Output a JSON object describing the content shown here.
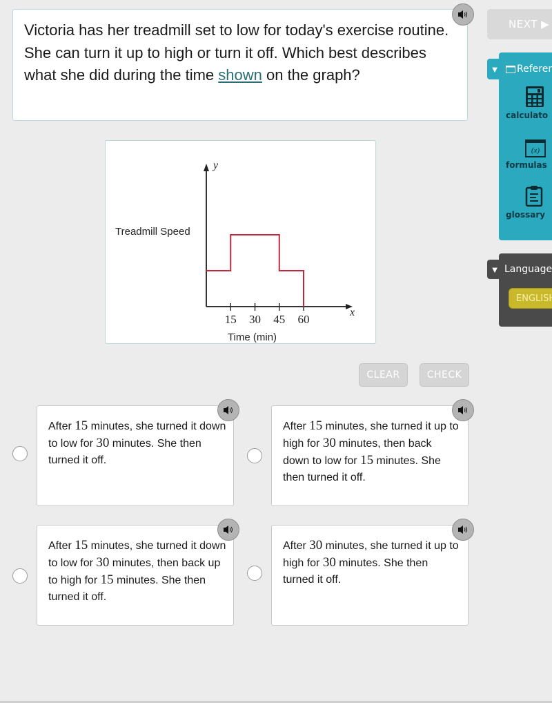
{
  "question": {
    "text_before_link": "Victoria has her treadmill set to low for today's exercise routine. She can turn it up to high or turn it off. Which best describes what she did during the time ",
    "link_text": "shown",
    "text_after_link": " on the graph?",
    "audio_icon": "speaker-icon"
  },
  "nav": {
    "next_label": "NEXT ▶"
  },
  "reference": {
    "toggle_icon": "▼",
    "title": "Referen",
    "items": [
      {
        "label": "calculato",
        "icon": "calculator-icon"
      },
      {
        "label": "formulas",
        "icon": "formulas-icon",
        "glyph": "(x)"
      },
      {
        "label": "glossary",
        "icon": "clipboard-icon"
      }
    ]
  },
  "language": {
    "toggle_icon": "▼",
    "title": "Language",
    "selected": "ENGLISH"
  },
  "actions": {
    "clear_label": "CLEAR",
    "check_label": "CHECK"
  },
  "choices": [
    {
      "segments": [
        "After ",
        "15",
        " minutes, she turned it down to low for ",
        "30",
        " minutes. She then turned it off."
      ]
    },
    {
      "segments": [
        "After ",
        "15",
        " minutes, she turned it up to high for ",
        "30",
        " minutes, then back down to low for ",
        "15",
        " minutes. She then turned it off."
      ]
    },
    {
      "segments": [
        "After ",
        "15",
        " minutes, she turned it down to low for ",
        "30",
        " minutes, then back up to high for ",
        "15",
        " minutes. She then turned it off."
      ]
    },
    {
      "segments": [
        "After ",
        "30",
        " minutes, she turned it up to high for ",
        "30",
        " minutes. She then turned it off."
      ]
    }
  ],
  "colors": {
    "accent_teal": "#2aa9bf",
    "line_red": "#c0283c",
    "language_yellow": "#c9b82a",
    "link_teal": "#2a6f77"
  },
  "chart_data": {
    "type": "line",
    "title": "",
    "xlabel": "Time (min)",
    "ylabel": "Treadmill Speed",
    "x_axis_var": "x",
    "y_axis_var": "y",
    "x_ticks": [
      15,
      30,
      45,
      60
    ],
    "xlim": [
      0,
      70
    ],
    "ylim": [
      0,
      3
    ],
    "y_levels": {
      "off": 0,
      "low": 1,
      "high": 2
    },
    "series": [
      {
        "name": "Treadmill Speed",
        "step": true,
        "points": [
          [
            0,
            1
          ],
          [
            15,
            1
          ],
          [
            15,
            2
          ],
          [
            45,
            2
          ],
          [
            45,
            1
          ],
          [
            60,
            1
          ],
          [
            60,
            0
          ]
        ]
      }
    ],
    "grid": false
  }
}
